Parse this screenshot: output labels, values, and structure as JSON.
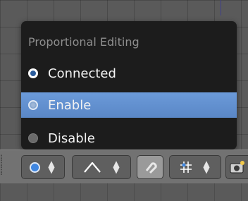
{
  "popup": {
    "title": "Proportional Editing",
    "items": [
      {
        "label": "Connected",
        "icon": "radio-connected-icon",
        "state": "normal"
      },
      {
        "label": "Enable",
        "icon": "radio-enable-icon",
        "state": "selected"
      },
      {
        "label": "Disable",
        "icon": "radio-disable-icon",
        "state": "normal"
      }
    ]
  },
  "header": {
    "proportional_icon": "proportional-editing-icon",
    "falloff_icon": "falloff-curve-icon",
    "snap_icon": "magnet-icon",
    "snap_element_icon": "snap-grid-icon",
    "render_icon": "camera-icon"
  },
  "colors": {
    "menu_bg": "#1c1c1c",
    "selected_bg": "#6b9ad9",
    "header_bg": "#727272",
    "accent_blue": "#3f86e0"
  }
}
